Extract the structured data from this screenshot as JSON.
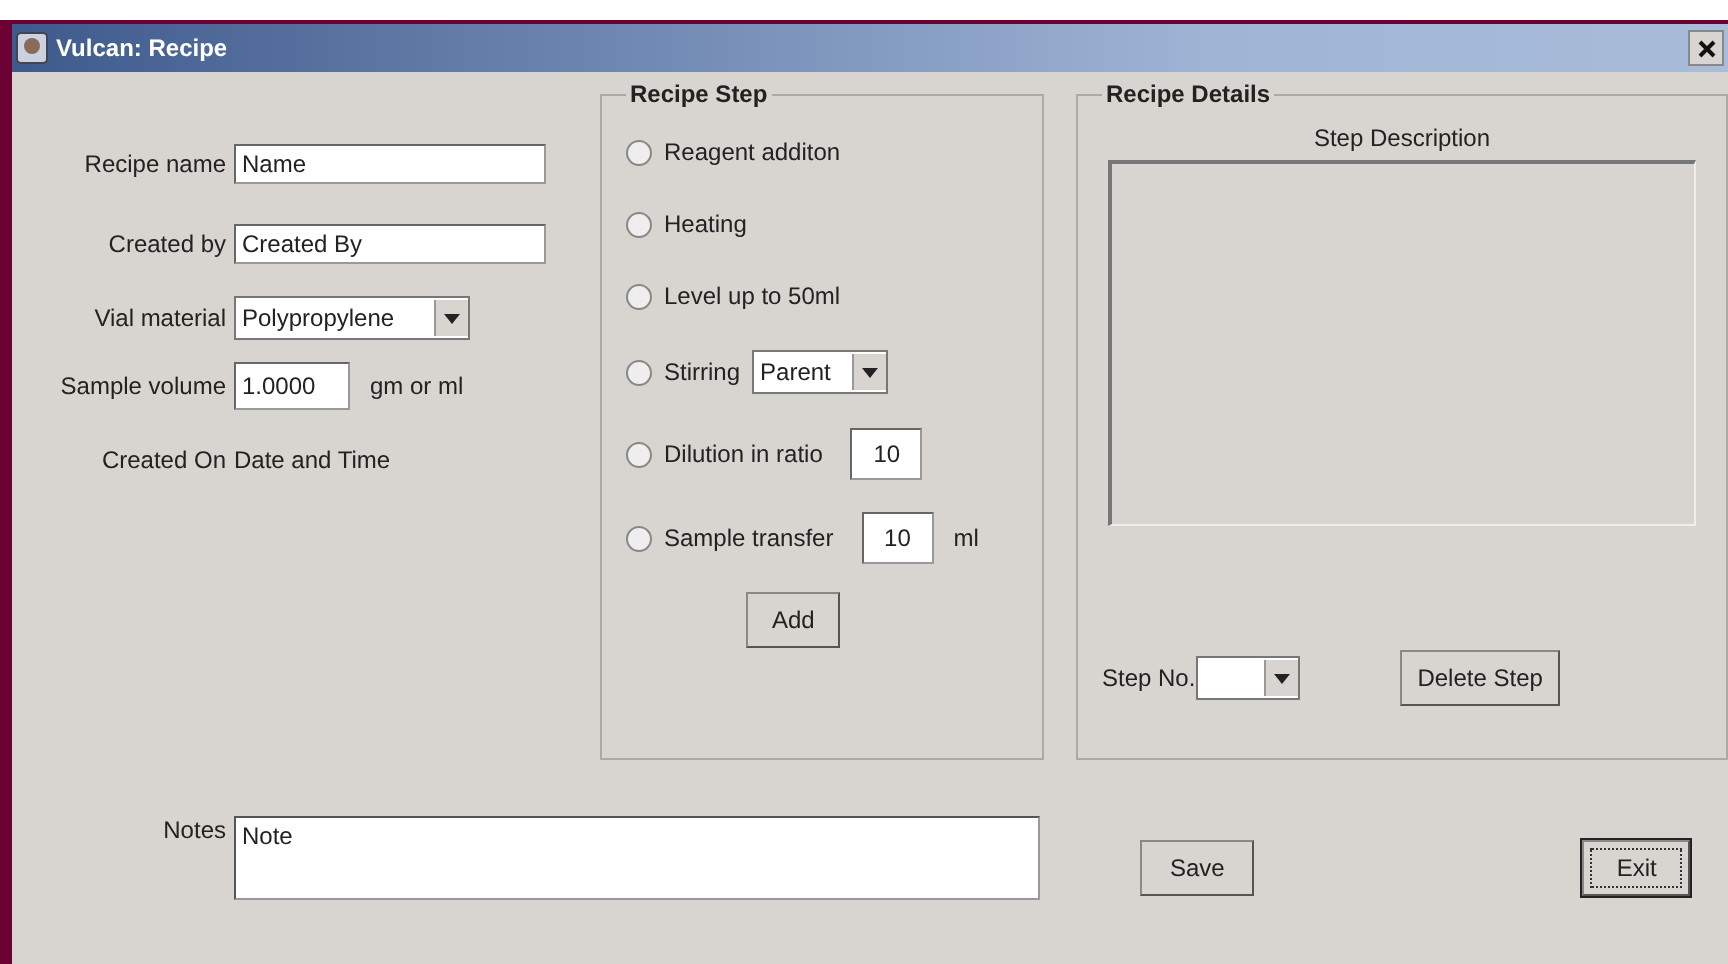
{
  "window": {
    "title": "Vulcan: Recipe"
  },
  "form": [
    {
      "kind": "text",
      "label": "Recipe name",
      "value": "Name"
    },
    {
      "kind": "text",
      "label": "Created by",
      "value": "Created By"
    },
    {
      "kind": "select",
      "label": "Vial material",
      "value": "Polypropylene"
    },
    {
      "kind": "number",
      "label": "Sample volume",
      "value": "1.0000",
      "unit": "gm or ml"
    },
    {
      "kind": "info",
      "label": "Created On",
      "value": "Date and Time"
    }
  ],
  "recipe_step": {
    "title": "Recipe Step",
    "options": [
      {
        "kind": "plain",
        "label": "Reagent additon",
        "selected": false
      },
      {
        "kind": "plain",
        "label": "Heating",
        "selected": false
      },
      {
        "kind": "plain",
        "label": "Level up to 50ml",
        "selected": false
      },
      {
        "kind": "select",
        "label": "Stirring",
        "value": "Parent",
        "selected": false
      },
      {
        "kind": "number",
        "label": "Dilution in ratio",
        "value": "10",
        "selected": false
      },
      {
        "kind": "number",
        "label": "Sample transfer",
        "value": "10",
        "unit": "ml",
        "selected": false
      }
    ],
    "add_button": "Add"
  },
  "recipe_details": {
    "title": "Recipe Details",
    "description_label": "Step Description",
    "step_label": "Step No.",
    "delete_button": "Delete Step"
  },
  "notes": {
    "label": "Notes",
    "value": "Note"
  },
  "buttons": [
    {
      "label": "Save",
      "focused": false
    },
    {
      "label": "Exit",
      "focused": true
    }
  ]
}
